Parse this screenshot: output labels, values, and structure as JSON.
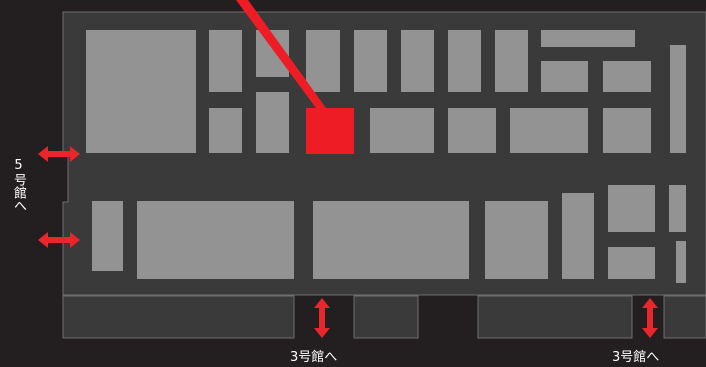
{
  "colors": {
    "background": "#231f20",
    "floor": "#3a3a3a",
    "floor_outline": "#6e6e6e",
    "booth": "#939393",
    "highlight": "#ee1c25",
    "arrow": "#e8262b",
    "label_text": "#ffffff"
  },
  "labels": {
    "to_building_5": "5号館へ",
    "to_building_3_left": "3号館へ",
    "to_building_3_right": "3号館へ"
  },
  "icons": {
    "pointer": "red-pointer-line",
    "arrows": "double-headed-arrow"
  }
}
